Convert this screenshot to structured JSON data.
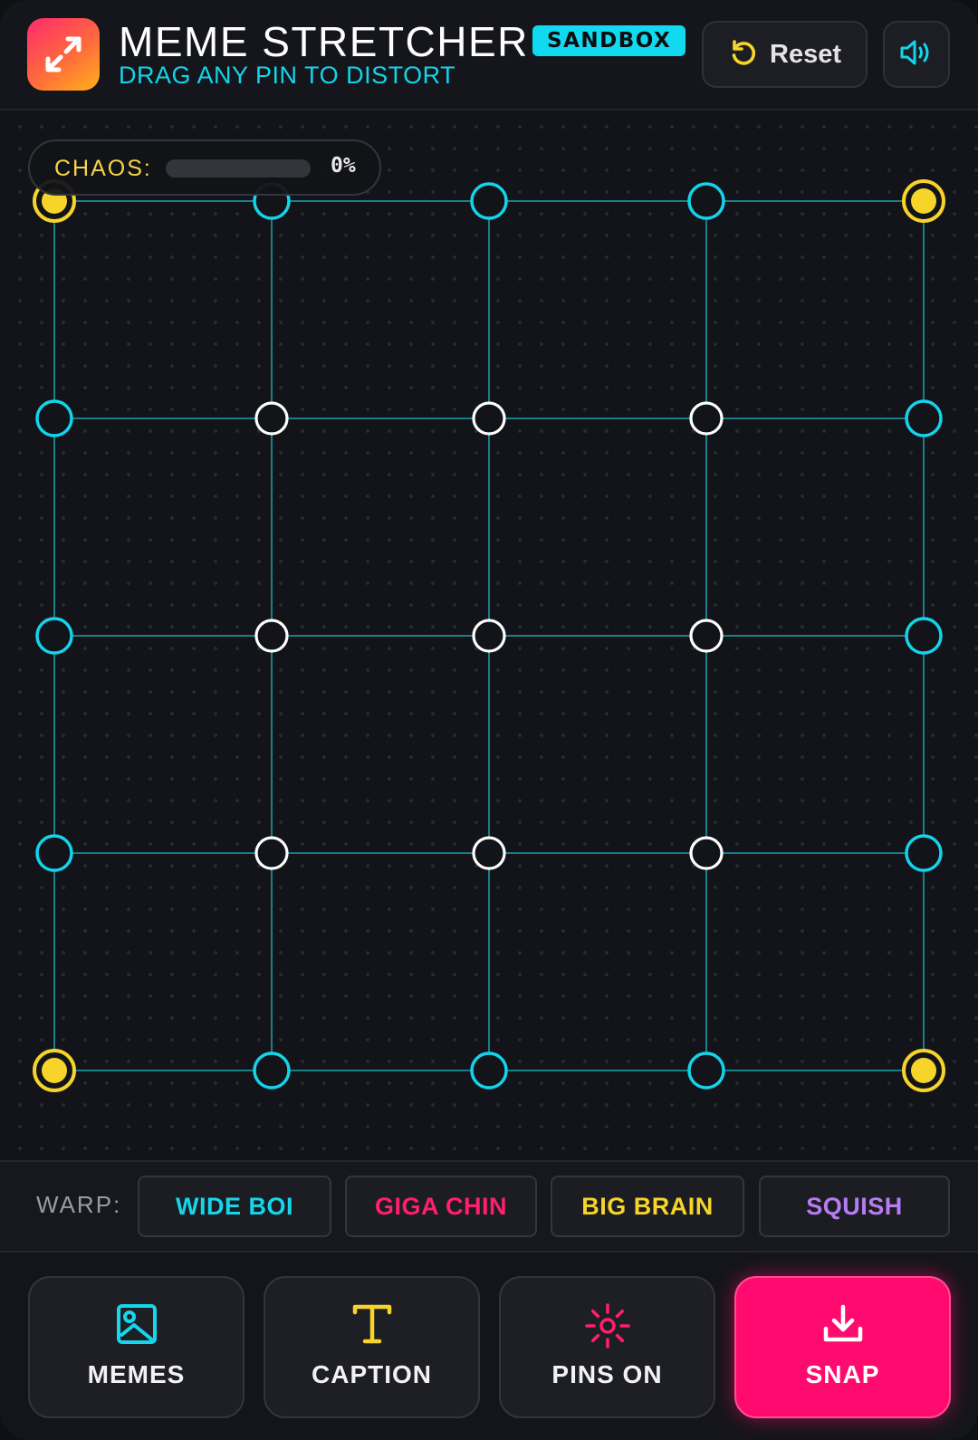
{
  "header": {
    "title": "MEME STRETCHER",
    "badge": "SANDBOX",
    "subtitle": "DRAG ANY PIN TO DISTORT",
    "reset_label": "Reset",
    "app_icon": "expand-arrows-icon",
    "reset_icon": "rotate-ccw-icon",
    "sound_icon": "volume-icon"
  },
  "chaos": {
    "label": "CHAOS:",
    "value_text": "0%",
    "level": 0
  },
  "pin_grid": {
    "rows": 5,
    "cols": 5,
    "pin_types": [
      [
        "anchor",
        "edge",
        "edge",
        "edge",
        "anchor"
      ],
      [
        "edge",
        "inner",
        "inner",
        "inner",
        "edge"
      ],
      [
        "edge",
        "inner",
        "inner",
        "inner",
        "edge"
      ],
      [
        "edge",
        "inner",
        "inner",
        "inner",
        "edge"
      ],
      [
        "anchor",
        "edge",
        "edge",
        "edge",
        "anchor"
      ]
    ]
  },
  "warp": {
    "label": "WARP:",
    "presets": [
      {
        "label": "WIDE BOI",
        "color": "#16d6ec"
      },
      {
        "label": "GIGA CHIN",
        "color": "#ff1f6b"
      },
      {
        "label": "BIG BRAIN",
        "color": "#f6d42a"
      },
      {
        "label": "SQUISH",
        "color": "#b77cf3"
      }
    ]
  },
  "toolbar": {
    "buttons": [
      {
        "label": "MEMES",
        "icon": "image-icon",
        "color": "#16d6ec"
      },
      {
        "label": "CAPTION",
        "icon": "text-t-icon",
        "color": "#f6d42a"
      },
      {
        "label": "PINS ON",
        "icon": "burst-icon",
        "color": "#ff1f6b"
      },
      {
        "label": "SNAP",
        "icon": "download-icon",
        "color": "#ffffff"
      }
    ]
  },
  "colors": {
    "accent_cyan": "#13d4ea",
    "accent_yellow": "#f6d42a",
    "accent_pink": "#ff0a6e",
    "grid_line": "#167f8c"
  }
}
